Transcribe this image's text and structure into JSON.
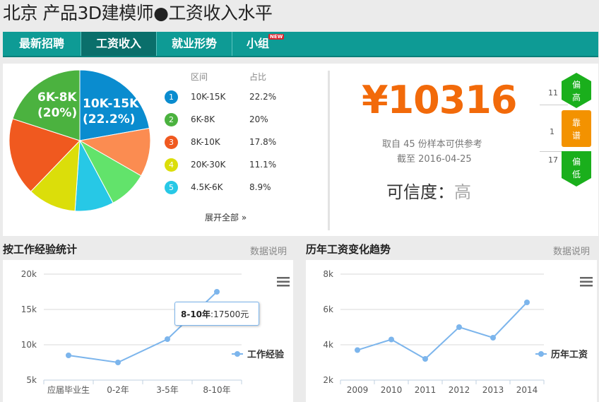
{
  "page_title": "北京 产品3D建模师●工资收入水平",
  "nav": {
    "items": [
      {
        "label": "最新招聘",
        "active": false
      },
      {
        "label": "工资收入",
        "active": true
      },
      {
        "label": "就业形势",
        "active": false
      },
      {
        "label": "小组",
        "active": false
      }
    ],
    "new_badge": "NEW"
  },
  "distribution": {
    "headers": {
      "range": "区间",
      "share": "占比"
    },
    "rows": [
      {
        "num": "1",
        "range": "10K-15K",
        "share": "22.2%",
        "color": "#0a8ccf",
        "value": 22.2
      },
      {
        "num": "2",
        "range": "6K-8K",
        "share": "20%",
        "color": "#4bb23f",
        "value": 20
      },
      {
        "num": "3",
        "range": "8K-10K",
        "share": "17.8%",
        "color": "#f0591f",
        "value": 17.8
      },
      {
        "num": "4",
        "range": "20K-30K",
        "share": "11.1%",
        "color": "#dbde0a",
        "value": 11.1
      },
      {
        "num": "5",
        "range": "4.5K-6K",
        "share": "8.9%",
        "color": "#27c8e6",
        "value": 8.9
      }
    ],
    "expand_label": "展开全部 »",
    "pie_labels": [
      {
        "line1": "10K-15K",
        "line2": "(22.2%)"
      },
      {
        "line1": "6K-8K",
        "line2": "(20%)"
      }
    ]
  },
  "salary": {
    "amount": "¥10316",
    "sample_line": "取自 45 份样本可供参考",
    "date_line": "截至  2016-04-25",
    "credibility_label": "可信度：",
    "credibility_value": "高"
  },
  "side": [
    {
      "count": "11",
      "label": "偏高",
      "color": "#1aaf1c"
    },
    {
      "count": "1",
      "label": "靠谱",
      "color": "#f39200"
    },
    {
      "count": "17",
      "label": "偏低",
      "color": "#1aaf1c"
    }
  ],
  "sections": {
    "experience_title": "按工作经验统计",
    "trend_title": "历年工资变化趋势",
    "data_note": "数据说明"
  },
  "chart_data": [
    {
      "type": "line",
      "title": "按工作经验统计",
      "categories": [
        "应届毕业生",
        "0-2年",
        "3-5年",
        "8-10年"
      ],
      "series": [
        {
          "name": "工作经验",
          "values": [
            8500,
            7500,
            10800,
            17500
          ]
        }
      ],
      "y_ticks": [
        "5k",
        "10k",
        "15k",
        "20k"
      ],
      "ylim": [
        5000,
        20000
      ],
      "tooltip": {
        "label": "8-10年",
        "value": ":17500元"
      },
      "legend": "right"
    },
    {
      "type": "line",
      "title": "历年工资变化趋势",
      "categories": [
        "2009",
        "2010",
        "2011",
        "2012",
        "2013",
        "2014"
      ],
      "series": [
        {
          "name": "历年工资",
          "values": [
            3700,
            4300,
            3200,
            5000,
            4400,
            6400
          ]
        }
      ],
      "y_ticks": [
        "2k",
        "4k",
        "6k",
        "8k"
      ],
      "ylim": [
        2000,
        8000
      ],
      "legend": "right"
    }
  ]
}
